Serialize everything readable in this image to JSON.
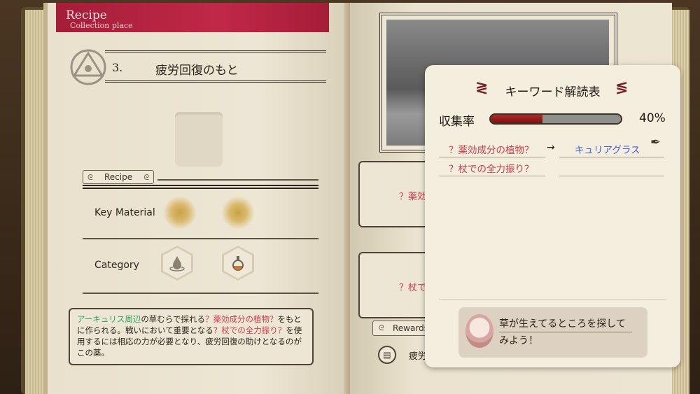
{
  "left_page": {
    "tab_title": "Recipe",
    "tab_subtitle": "Collection place",
    "recipe_number": "3.",
    "recipe_name": "疲労回復のもと",
    "section_label": "Recipe",
    "key_material_label": "Key Material",
    "category_label": "Category",
    "description": {
      "p1": "アーキュリス周辺",
      "p2": "の草むらで採れる",
      "p3": "？薬効成分の植物？",
      "p4": "をもとに作られる。戦いにおいて重要となる",
      "p5": "？杖での全",
      "p6": "力振り？",
      "p7": "を使用するには相応の力が必要となり、疲労回復の助けとなるのがこの薬。"
    }
  },
  "right_page": {
    "fragment_1": "？薬効",
    "fragment_2": "？杖での",
    "rewards_label": "Rewards",
    "reward_item": "疲労"
  },
  "keyword_panel": {
    "title": "キーワード解読表",
    "rate_label": "収集率",
    "rate_value": "40%",
    "rate_fraction": 0.4,
    "keywords": [
      {
        "hint": "？薬効成分の植物？",
        "arrow": "→",
        "answer": "キュリアグラス"
      },
      {
        "hint": "？杖での全力振り？",
        "answer": ""
      }
    ],
    "hint_line1": "草が生えてるところを探して",
    "hint_line2": "みよう！"
  },
  "colors": {
    "tab_red": "#b02240",
    "keyword_red": "#d13a4a",
    "keyword_blue": "#4a5ad8",
    "highlight_green": "#2aa55a",
    "bar_fill": "#9a1e1e"
  }
}
